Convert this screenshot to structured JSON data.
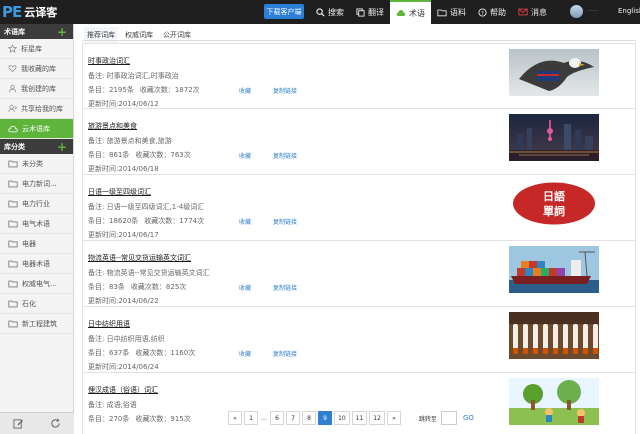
{
  "app": {
    "logo_mark": "PE",
    "logo_text": "云译客",
    "download_label": "下载客户端"
  },
  "nav": [
    {
      "label": "搜索",
      "icon": "search-icon"
    },
    {
      "label": "翻译",
      "icon": "translate-icon"
    },
    {
      "label": "术语",
      "icon": "term-icon",
      "active": true
    },
    {
      "label": "语料",
      "icon": "folder-icon"
    },
    {
      "label": "帮助",
      "icon": "help-icon"
    },
    {
      "label": "消息",
      "icon": "mail-icon"
    }
  ],
  "user": {
    "name": "······",
    "lang": "English"
  },
  "sidebar": {
    "term_header": "术语库",
    "term_items": [
      {
        "label": "标星库",
        "icon": "star-icon"
      },
      {
        "label": "我收藏的库",
        "icon": "heart-icon"
      },
      {
        "label": "我创建的库",
        "icon": "user-icon"
      },
      {
        "label": "共享给我的库",
        "icon": "share-user-icon"
      },
      {
        "label": "云术语库",
        "icon": "cloud-icon",
        "active": true
      }
    ],
    "category_header": "库分类",
    "category_items": [
      {
        "label": "未分类"
      },
      {
        "label": "电力新词..."
      },
      {
        "label": "电力行业"
      },
      {
        "label": "电气术语"
      },
      {
        "label": "电器"
      },
      {
        "label": "电器术语"
      },
      {
        "label": "权威电气..."
      },
      {
        "label": "石化"
      },
      {
        "label": "新工程建筑"
      }
    ]
  },
  "tabs": [
    {
      "label": "推荐词库",
      "active": true
    },
    {
      "label": "权威词库"
    },
    {
      "label": "公开词库"
    }
  ],
  "labels": {
    "fav": "收藏",
    "copy": "复制链接"
  },
  "cards": [
    {
      "title": "时事政治词汇",
      "note": "备注: 时事政治词汇,时事政治",
      "count": "条目：2195条",
      "favs": "收藏次数：1872次",
      "date": "更新时间:2014/06/12",
      "img": "eagle"
    },
    {
      "title": "旅游景点和美食",
      "note": "备注: 旅游景点和美食,旅游",
      "count": "条目：861条",
      "favs": "收藏次数：763次",
      "date": "更新时间:2014/06/18",
      "img": "city"
    },
    {
      "title": "日语一级至四级词汇",
      "note": "备注: 日语一级至四级词汇,1-4级词汇",
      "count": "条目：18620条",
      "favs": "收藏次数：1774次",
      "date": "更新时间:2014/06/17",
      "img": "japanese",
      "img_text_1": "日語",
      "img_text_2": "單詞"
    },
    {
      "title": "物流英语--常见交货运输英文词汇",
      "note": "备注: 物流英语--常见交货运输英文词汇",
      "count": "条目：83条",
      "favs": "收藏次数：825次",
      "date": "更新时间:2014/06/22",
      "img": "ship"
    },
    {
      "title": "日中纺织用语",
      "note": "备注: 日中纺织用语,纺织",
      "count": "条目：637条",
      "favs": "收藏次数：1160次",
      "date": "更新时间:2014/06/24",
      "img": "textile"
    },
    {
      "title": "俚汉成语（俗语）词汇",
      "note": "备注: 成语,俗语",
      "count": "条目：270条",
      "favs": "收藏次数：915次",
      "date": "",
      "img": "cartoon"
    }
  ],
  "pagination": {
    "pages": [
      "«",
      "1",
      "...",
      "6",
      "7",
      "8",
      "9",
      "10",
      "11",
      "12",
      "»"
    ],
    "active": "9",
    "goto_label": "跳转至",
    "go_label": "GO"
  },
  "colors": {
    "accent_green": "#5fb43c",
    "link_blue": "#2f80d0",
    "topbar": "#1f1f1f"
  }
}
